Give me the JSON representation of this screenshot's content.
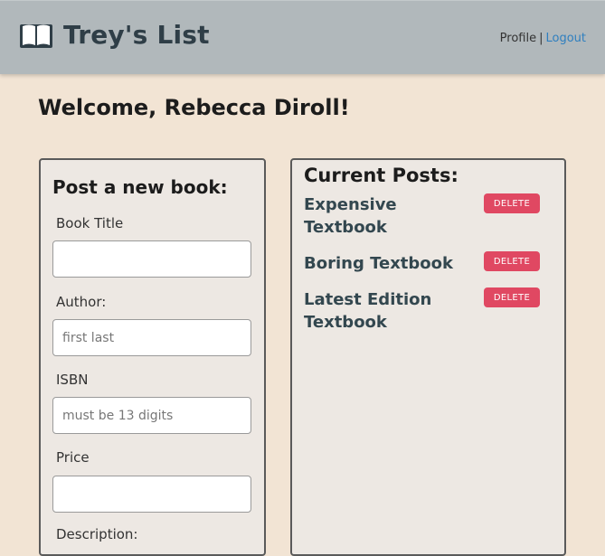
{
  "header": {
    "brand_icon": "open-book-icon",
    "brand_title": "Trey's List",
    "profile_link": "Profile",
    "separator": "|",
    "logout_link": "Logout"
  },
  "welcome_text": "Welcome, Rebecca Diroll!",
  "post_form": {
    "title": "Post a new book:",
    "fields": [
      {
        "label": "Book Title",
        "value": "",
        "placeholder": ""
      },
      {
        "label": "Author:",
        "value": "",
        "placeholder": "first last"
      },
      {
        "label": "ISBN",
        "value": "",
        "placeholder": "must be 13 digits"
      },
      {
        "label": "Price",
        "value": "",
        "placeholder": ""
      },
      {
        "label": "Description:"
      }
    ]
  },
  "current_posts": {
    "title": "Current Posts:",
    "delete_label": "DELETE",
    "items": [
      {
        "title": "Expensive Textbook"
      },
      {
        "title": "Boring Textbook"
      },
      {
        "title": "Latest Edition Textbook"
      }
    ]
  },
  "colors": {
    "header_bg": "#b1b8bb",
    "page_bg": "#f2e4d4",
    "panel_bg": "#ede8e3",
    "delete_button": "#e04862",
    "logout_link": "#2f7fbf",
    "post_title": "#33474f"
  }
}
